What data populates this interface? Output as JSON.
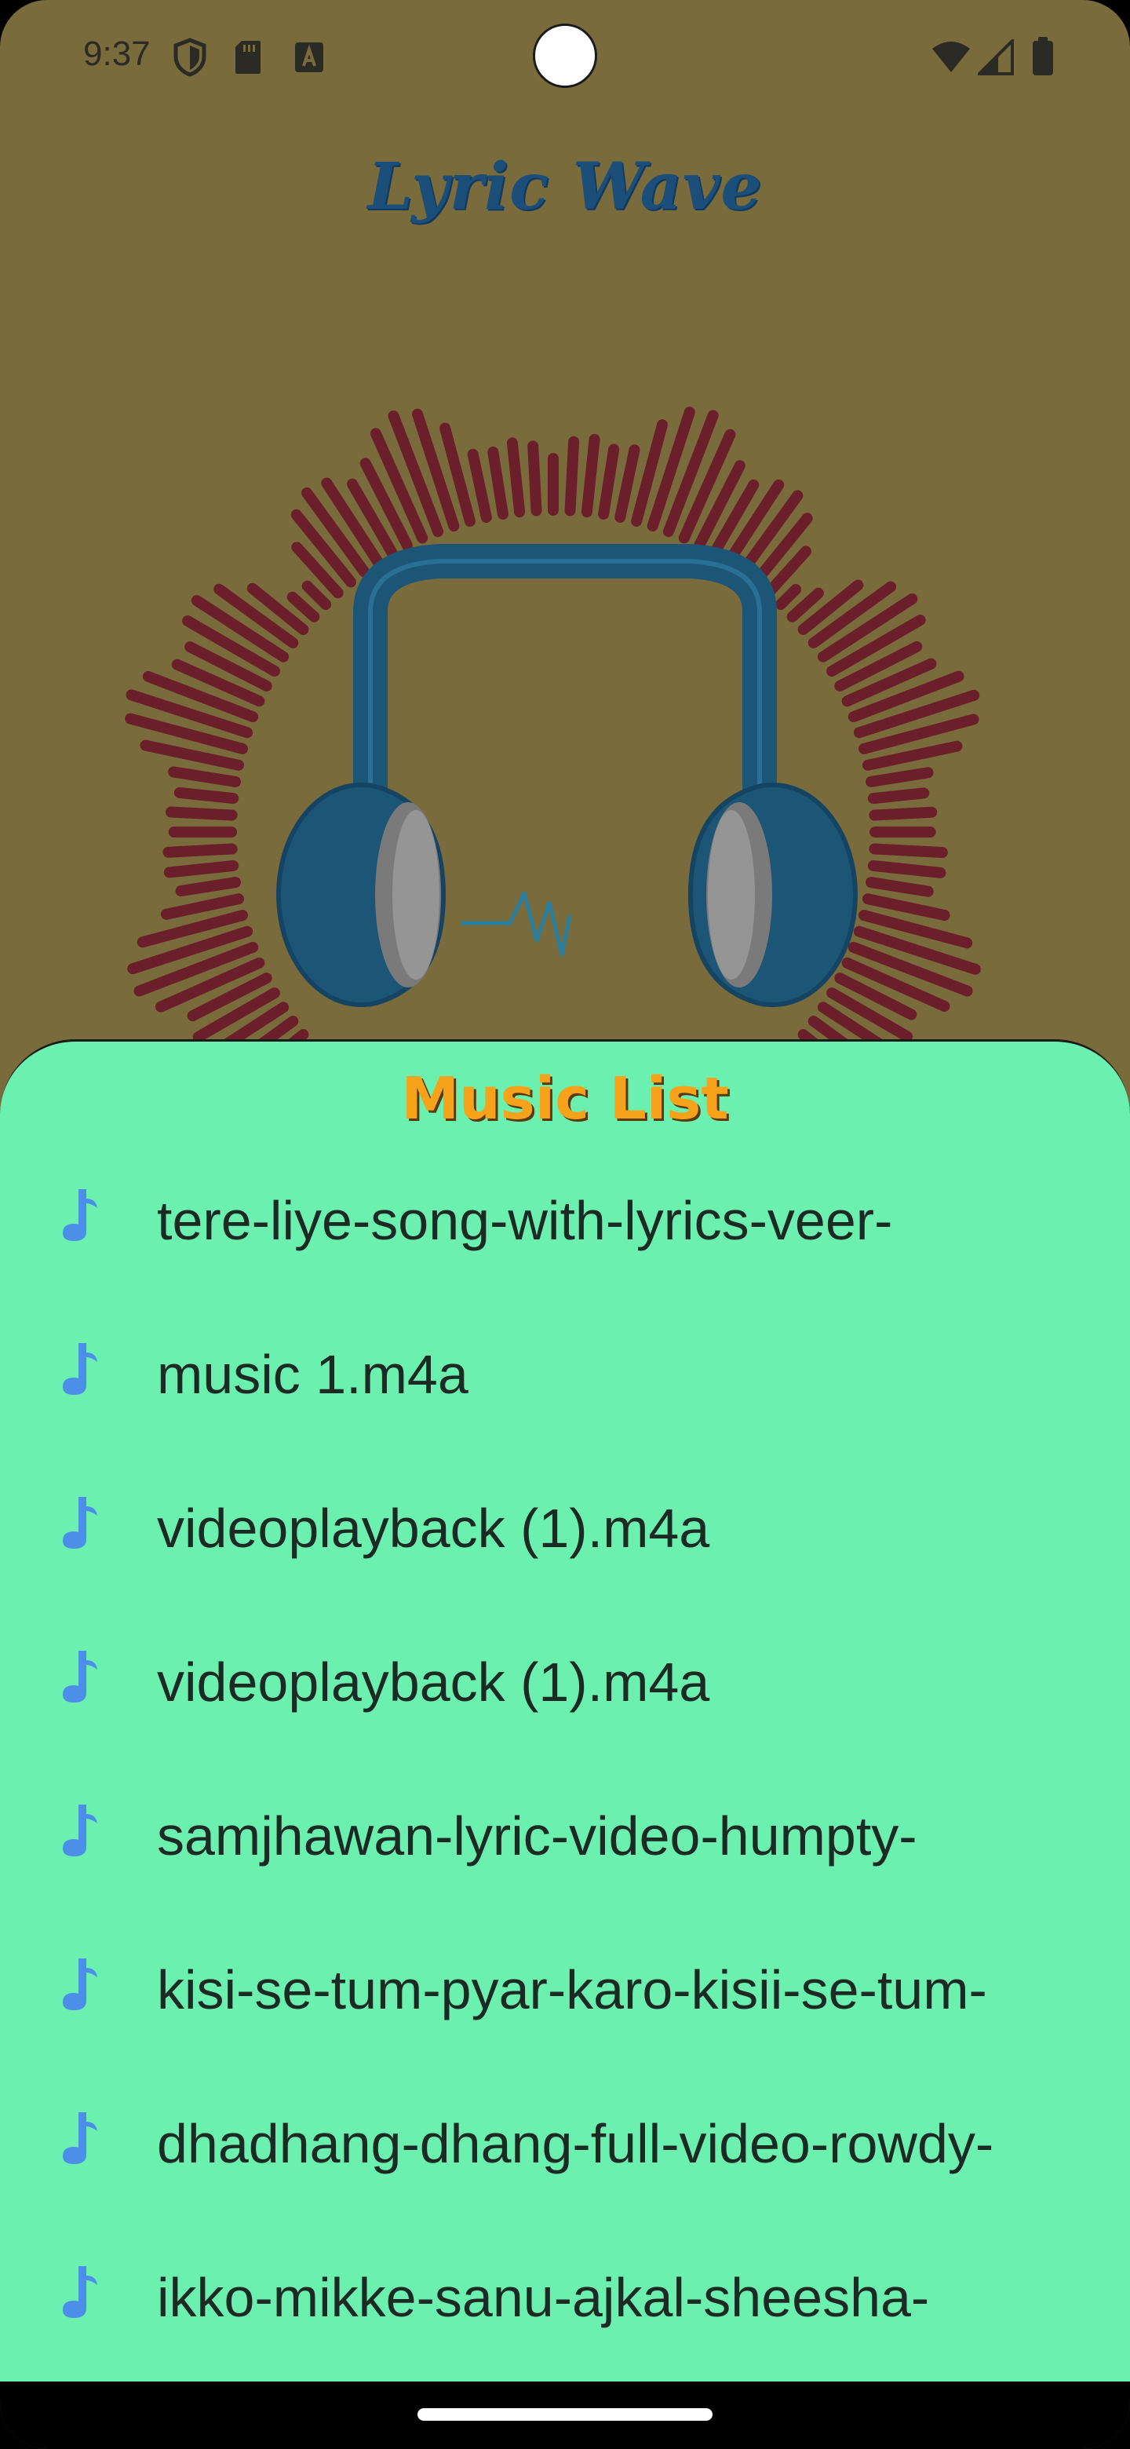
{
  "status_bar": {
    "time": "9:37",
    "left_icons": [
      "shield-icon",
      "sd-card-icon",
      "keyboard-a-icon"
    ],
    "right_icons": [
      "wifi-icon",
      "signal-icon",
      "battery-icon"
    ]
  },
  "app": {
    "title": "Lyric Wave",
    "title_color": "#1c4e7a",
    "background_color": "#7a6b3c"
  },
  "hero": {
    "graphic": "headphones-with-circular-audio-visualizer",
    "visualizer_color": "#6b1f2a",
    "headphone_color": "#1d5577"
  },
  "music_list": {
    "title": "Music List",
    "title_color": "#f7a21b",
    "background_color": "#6cf0b0",
    "icon": "music-note-icon",
    "icon_color": "#4b8fe8",
    "items": [
      {
        "name": "tere-liye-song-with-lyrics-veer-"
      },
      {
        "name": "music 1.m4a"
      },
      {
        "name": "videoplayback (1).m4a"
      },
      {
        "name": "videoplayback (1).m4a"
      },
      {
        "name": "samjhawan-lyric-video-humpty-"
      },
      {
        "name": "kisi-se-tum-pyar-karo-kisii-se-tum-"
      },
      {
        "name": "dhadhang-dhang-full-video-rowdy-"
      },
      {
        "name": "ikko-mikke-sanu-ajkal-sheesha-"
      }
    ]
  }
}
